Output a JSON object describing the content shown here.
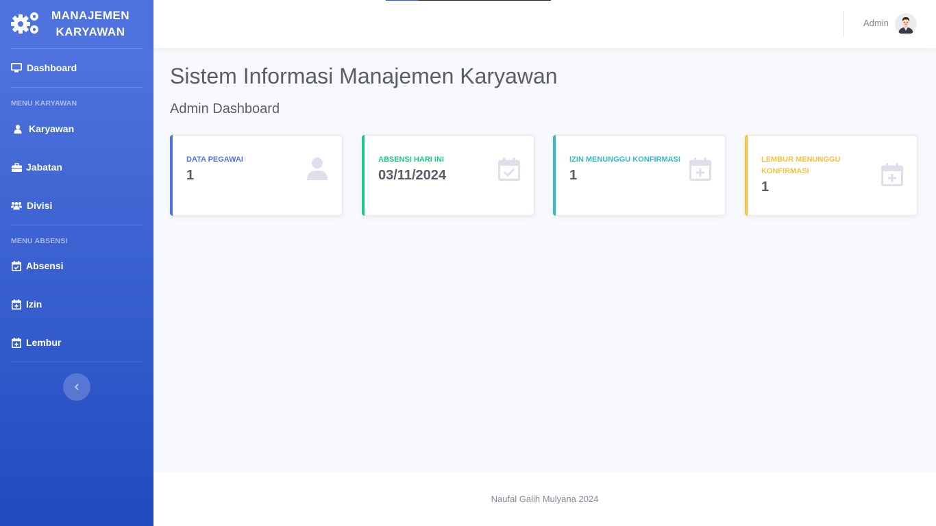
{
  "brand": {
    "line1": "MANAJEMEN",
    "line2": "KARYAWAN",
    "icon": "cogs-icon"
  },
  "sidebar": {
    "dashboard": "Dashboard",
    "heading_karyawan": "MENU KARYAWAN",
    "items_karyawan": [
      {
        "label": "Karyawan",
        "icon": "user-icon"
      },
      {
        "label": "Jabatan",
        "icon": "briefcase-icon"
      },
      {
        "label": "Divisi",
        "icon": "users-icon"
      }
    ],
    "heading_absensi": "MENU ABSENSI",
    "items_absensi": [
      {
        "label": "Absensi",
        "icon": "calendar-check-icon"
      },
      {
        "label": "Izin",
        "icon": "calendar-plus-icon"
      },
      {
        "label": "Lembur",
        "icon": "calendar-plus-icon"
      }
    ],
    "toggle_icon": "chevron-left-icon"
  },
  "topbar": {
    "user_name": "Admin"
  },
  "main": {
    "title": "Sistem Informasi Manajemen Karyawan",
    "subtitle": "Admin Dashboard",
    "cards": [
      {
        "title": "DATA PEGAWAI",
        "value": "1",
        "color": "#4e73df",
        "icon": "user-icon"
      },
      {
        "title": "ABSENSI HARI INI",
        "value": "03/11/2024",
        "color": "#1cc88a",
        "icon": "calendar-check-icon"
      },
      {
        "title": "IZIN MENUNGGU KONFIRMASI",
        "value": "1",
        "color": "#36b9cc",
        "icon": "calendar-plus-icon"
      },
      {
        "title": "LEMBUR MENUNGGU KONFIRMASI",
        "value": "1",
        "color": "#f6c23e",
        "icon": "calendar-plus-icon"
      }
    ]
  },
  "footer": {
    "text": "Naufal Galih Mulyana 2024"
  }
}
